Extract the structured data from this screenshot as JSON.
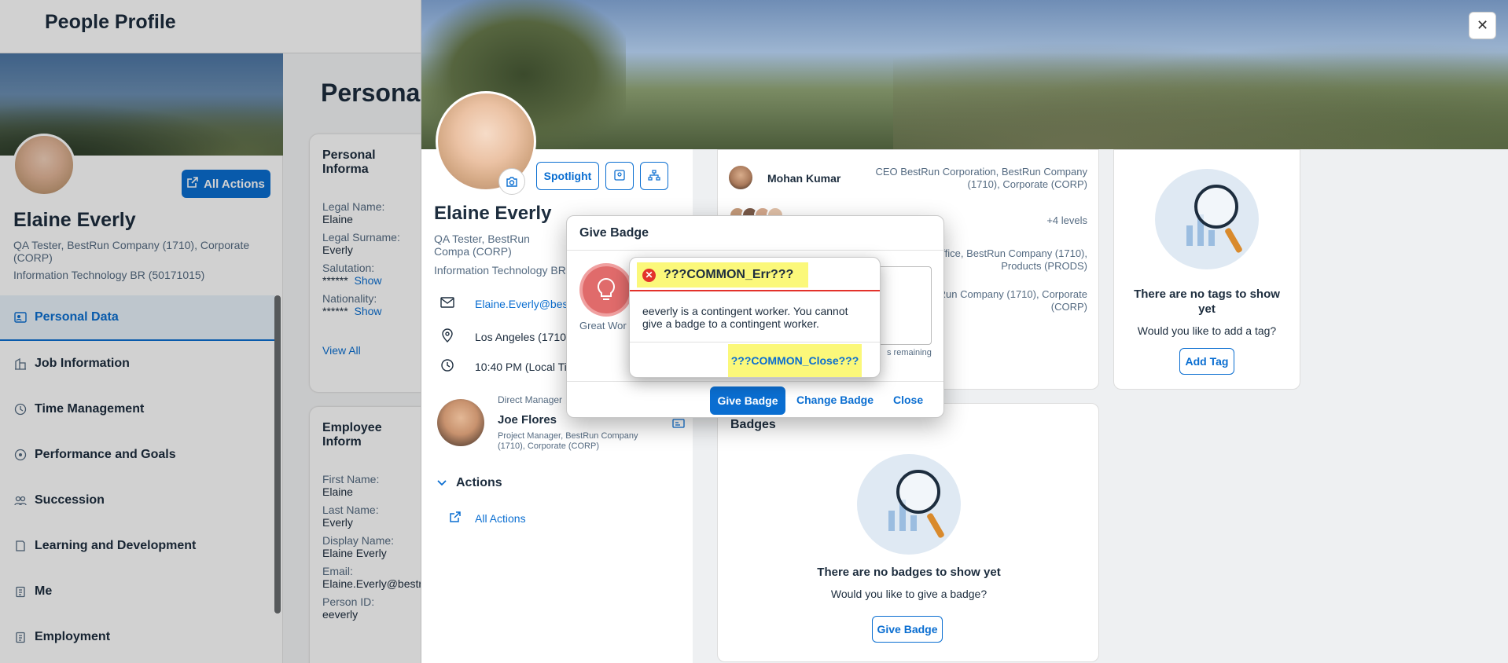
{
  "header": {
    "title": "People Profile"
  },
  "sidebar": {
    "all_actions": "All Actions",
    "name": "Elaine Everly",
    "title": "QA Tester, BestRun Company (1710), Corporate (CORP)",
    "department": "Information Technology BR (50171015)",
    "nav": [
      {
        "label": "Personal Data",
        "active": true
      },
      {
        "label": "Job Information"
      },
      {
        "label": "Time Management"
      },
      {
        "label": "Performance and Goals"
      },
      {
        "label": "Succession"
      },
      {
        "label": "Learning and Development"
      },
      {
        "label": "Me"
      },
      {
        "label": "Employment"
      }
    ]
  },
  "main": {
    "title": "Persona",
    "personal_info": {
      "heading": "Personal Informa",
      "legal_name_lbl": "Legal Name:",
      "legal_name": "Elaine",
      "legal_surname_lbl": "Legal Surname:",
      "legal_surname": "Everly",
      "salutation_lbl": "Salutation:",
      "salutation": "******",
      "nationality_lbl": "Nationality:",
      "nationality": "******",
      "show": "Show",
      "view_all": "View All"
    },
    "employee_info": {
      "heading": "Employee Inform",
      "first_name_lbl": "First Name:",
      "first_name": "Elaine",
      "last_name_lbl": "Last Name:",
      "last_name": "Everly",
      "display_name_lbl": "Display Name:",
      "display_name": "Elaine Everly",
      "email_lbl": "Email:",
      "email": "Elaine.Everly@bestr",
      "person_id_lbl": "Person ID:",
      "person_id": "eeverly"
    }
  },
  "quickview": {
    "spotlight": "Spotlight",
    "name": "Elaine Everly",
    "title": "QA Tester, BestRun Compa (CORP)",
    "department": "Information Technology BR",
    "email": "Elaine.Everly@bes",
    "location": "Los Angeles (1710-",
    "time": "10:40 PM (Local Ti",
    "manager_label": "Direct Manager",
    "manager_name": "Joe Flores",
    "manager_title": "Project Manager, BestRun Company (1710), Corporate (CORP)",
    "actions_heading": "Actions",
    "all_actions": "All Actions",
    "org": {
      "ceo_name": "Mohan Kumar",
      "ceo_title": "CEO BestRun Corporation, BestRun Company (1710), Corporate (CORP)",
      "levels": "+4 levels",
      "row2": "ent Office, BestRun Company (1710), Products (PRODS)",
      "row3": "er, BestRun Company (1710), Corporate (CORP)"
    },
    "tags": {
      "empty_title": "There are no tags to show yet",
      "empty_sub": "Would you like to add a tag?",
      "add_tag": "Add Tag"
    },
    "badges": {
      "heading": "Badges",
      "empty_title": "There are no badges to show yet",
      "empty_sub": "Would you like to give a badge?",
      "give_badge": "Give Badge"
    }
  },
  "give_badge_dialog": {
    "title": "Give Badge",
    "badge_label": "Great Wor",
    "remaining": "s remaining",
    "give_badge": "Give Badge",
    "change_badge": "Change Badge",
    "close": "Close"
  },
  "error_dialog": {
    "title": "???COMMON_Err???",
    "message": "eeverly is a contingent worker. You cannot give a badge to a contingent worker.",
    "close": "???COMMON_Close???"
  },
  "colors": {
    "accent": "#0a6ed1",
    "error": "#e3322b",
    "highlight": "#fbf87a"
  },
  "icons": [
    "close-icon",
    "external-link-icon",
    "camera-icon",
    "mail-icon",
    "location-icon",
    "clock-icon",
    "error-icon",
    "lightbulb-icon",
    "chevron-down-icon"
  ]
}
